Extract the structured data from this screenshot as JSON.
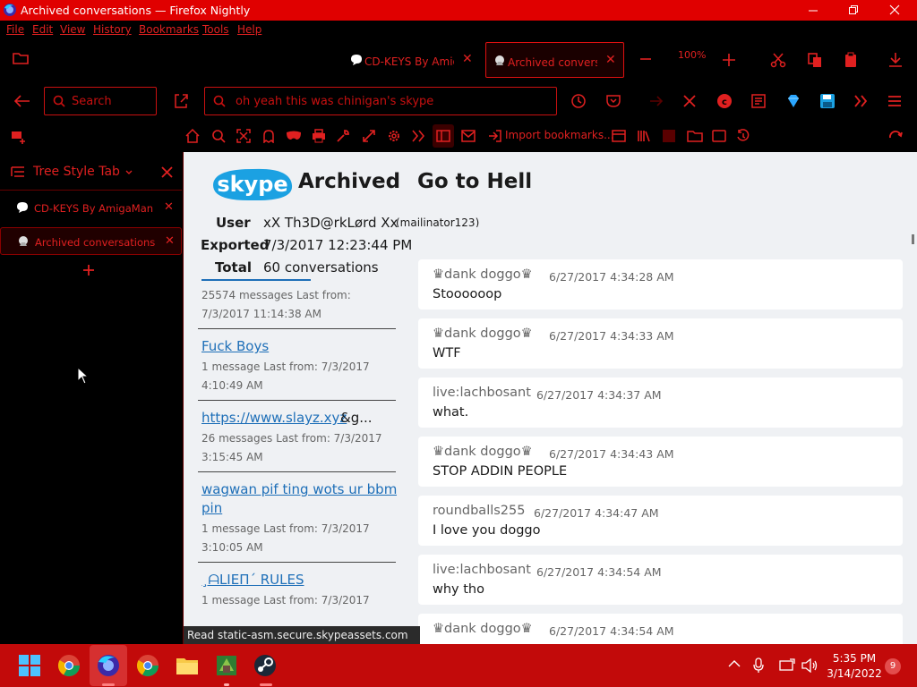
{
  "window": {
    "title": "Archived conversations — Firefox Nightly"
  },
  "menu": [
    "File",
    "Edit",
    "View",
    "History",
    "Bookmarks",
    "Tools",
    "Help"
  ],
  "tabs": [
    {
      "label": "CD-KEYS By AmigaMan",
      "active": false
    },
    {
      "label": "Archived conversations",
      "active": true
    }
  ],
  "toolbar": {
    "zoom": "100%"
  },
  "navbar": {
    "search_placeholder": "Search",
    "url": "oh yeah this was chinigan's skype"
  },
  "bookmarks": {
    "import_label": "Import bookmarks..."
  },
  "sidebar": {
    "title": "Tree Style Tab",
    "tabs": [
      {
        "label": "CD-KEYS By AmigaMan"
      },
      {
        "label": "Archived conversations"
      }
    ]
  },
  "page": {
    "title": "Archived conversations",
    "chat_title": "Go to Hell",
    "user_label": "User",
    "user_value": "xX Th3D@rkLørd Xx",
    "user_sub": "(mailinator123)",
    "exported_label": "Exported",
    "exported_value": "7/3/2017 12:23:44 PM",
    "total_label": "Total",
    "total_value": "60 conversations"
  },
  "conversations": [
    {
      "name": "",
      "meta1": "25574 messages    Last from:",
      "meta2": "7/3/2017 11:14:38 AM"
    },
    {
      "name": "Fuck Boys",
      "meta1": "1 message    Last from: 7/3/2017",
      "meta2": "4:10:49 AM"
    },
    {
      "name": "https://www.slayz.xyz",
      "extra": "&g...",
      "meta1": "26 messages    Last from: 7/3/2017",
      "meta2": "3:15:45 AM"
    },
    {
      "name": "wagwan pif ting wots ur bbm",
      "name2": "pin",
      "meta1": "1 message    Last from: 7/3/2017",
      "meta2": "3:10:05 AM"
    },
    {
      "name": "¸ᗩLIEП´ RULES",
      "meta1": "1 message    Last from: 7/3/2017",
      "meta2": ""
    }
  ],
  "messages": [
    {
      "who": "♛dank doggo♛",
      "when": "6/27/2017 4:34:28 AM",
      "body": "Stoooooop"
    },
    {
      "who": "♛dank doggo♛",
      "when": "6/27/2017 4:34:33 AM",
      "body": "WTF"
    },
    {
      "who": "live:lachbosant",
      "when": "6/27/2017 4:34:37 AM",
      "body": "what."
    },
    {
      "who": "♛dank doggo♛",
      "when": "6/27/2017 4:34:43 AM",
      "body": "STOP ADDIN PEOPLE"
    },
    {
      "who": "roundballs255",
      "when": "6/27/2017 4:34:47 AM",
      "body": "I love you doggo"
    },
    {
      "who": "live:lachbosant",
      "when": "6/27/2017 4:34:54 AM",
      "body": "why tho"
    },
    {
      "who": "♛dank doggo♛",
      "when": "6/27/2017 4:34:54 AM",
      "body": ""
    }
  ],
  "status": "Read static-asm.secure.skypeassets.com",
  "taskbar": {
    "time": "5:35 PM",
    "date": "3/14/2022",
    "notifications": "9"
  },
  "colors": {
    "accent": "#e02020",
    "titlebar": "#e00000",
    "taskbar": "#c20a0a",
    "link": "#1e6fb8",
    "skype": "#1ba1e2"
  }
}
